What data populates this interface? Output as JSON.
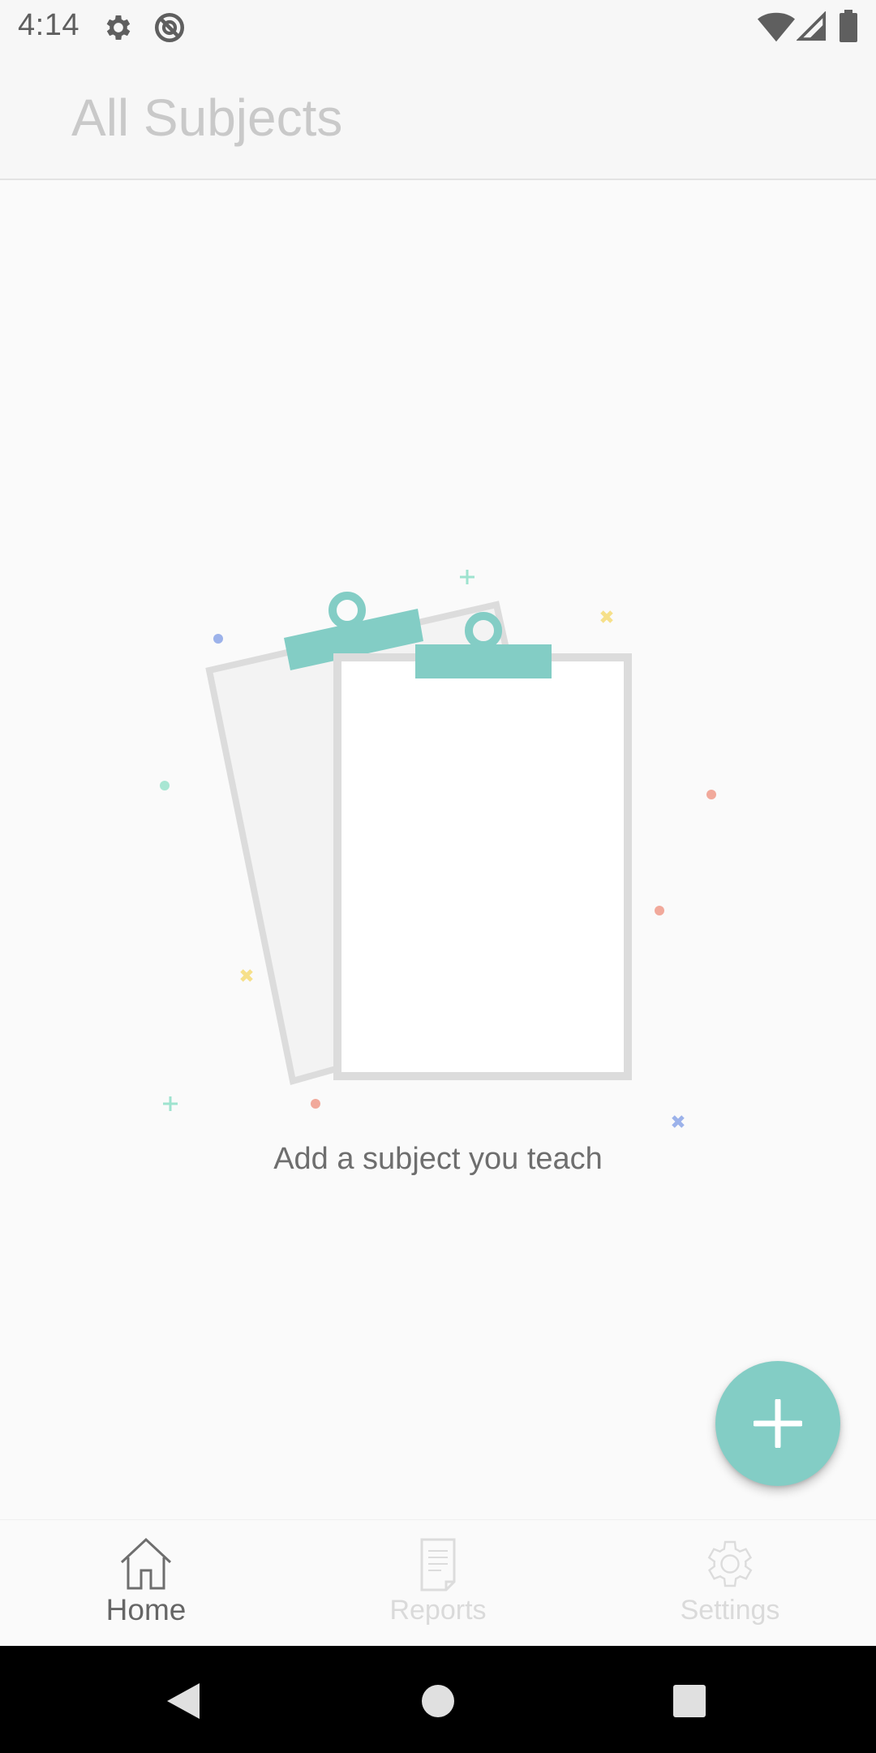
{
  "status_bar": {
    "time": "4:14",
    "icons_left": [
      "gear-icon",
      "no-disturb-icon"
    ],
    "icons_right": [
      "wifi-icon",
      "cell-signal-icon",
      "battery-icon"
    ]
  },
  "app_bar": {
    "title": "All Subjects"
  },
  "empty_state": {
    "illustration": "clipboards-illustration",
    "message": "Add a subject you teach"
  },
  "fab": {
    "icon": "plus-icon",
    "color": "#83cdc5"
  },
  "bottom_nav": {
    "items": [
      {
        "label": "Home",
        "icon": "home-icon",
        "active": true
      },
      {
        "label": "Reports",
        "icon": "report-icon",
        "active": false
      },
      {
        "label": "Settings",
        "icon": "settings-icon",
        "active": false
      }
    ]
  },
  "system_nav": {
    "buttons": [
      "back-icon",
      "home-circle-icon",
      "recents-icon"
    ]
  },
  "colors": {
    "accent": "#83cdc5",
    "title_text": "#c9c9c9",
    "message_text": "#6e6e6e"
  }
}
